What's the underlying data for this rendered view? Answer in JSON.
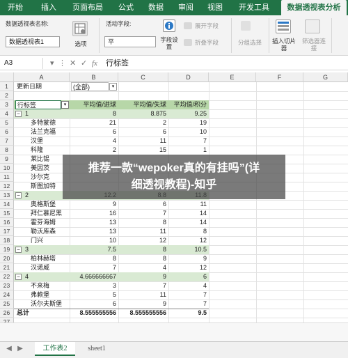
{
  "ribbon_tabs": [
    "开始",
    "插入",
    "页面布局",
    "公式",
    "数据",
    "审阅",
    "视图",
    "开发工具",
    "数据透视表分析"
  ],
  "ribbon": {
    "pt_name_label": "数据透视表名称:",
    "pt_name_value": "数据透视表1",
    "options_label": "选项",
    "active_field_label": "活动字段:",
    "active_field_value": "平",
    "field_settings_label": "字段设置",
    "expand_field_label": "展开字段",
    "collapse_field_label": "折叠字段",
    "group_select_label": "分组选择",
    "insert_slicer_label": "插入切片器",
    "filter_conn_label": "筛选器连接"
  },
  "formula_bar": {
    "cell_ref": "A3",
    "fx": "fx",
    "content": "行标签"
  },
  "columns": [
    "A",
    "B",
    "C",
    "D",
    "E",
    "F",
    "G"
  ],
  "row_numbers": [
    "1",
    "2",
    "3",
    "4",
    "5",
    "6",
    "7",
    "8",
    "9",
    "10",
    "11",
    "12",
    "13",
    "14",
    "15",
    "16",
    "17",
    "18",
    "19",
    "20",
    "21",
    "22",
    "23",
    "24",
    "25",
    "26",
    "27"
  ],
  "filter": {
    "label": "更新日期",
    "value": "(全部)"
  },
  "pivot_header": {
    "row_label": "行标签",
    "col_b": "平均值/进球",
    "col_c": "平均值/失球",
    "col_d": "平均值/积分"
  },
  "rows": [
    {
      "type": "group",
      "a": "1",
      "b": "8",
      "c": "8.875",
      "d": "9.25"
    },
    {
      "type": "item",
      "a": "多特蒙德",
      "b": "21",
      "c": "2",
      "d": "19"
    },
    {
      "type": "item",
      "a": "法兰克福",
      "b": "6",
      "c": "6",
      "d": "10"
    },
    {
      "type": "item",
      "a": "汉堡",
      "b": "4",
      "c": "11",
      "d": "7"
    },
    {
      "type": "item",
      "a": "科隆",
      "b": "2",
      "c": "15",
      "d": "1"
    },
    {
      "type": "item",
      "a": "莱比锡",
      "b": "",
      "c": "",
      "d": ""
    },
    {
      "type": "item",
      "a": "美因茨",
      "b": "",
      "c": "",
      "d": ""
    },
    {
      "type": "item",
      "a": "沙尔克",
      "b": "",
      "c": "",
      "d": ""
    },
    {
      "type": "item",
      "a": "斯图加特",
      "b": "",
      "c": "",
      "d": ""
    },
    {
      "type": "group",
      "a": "2",
      "b": "12.2",
      "c": "8.8",
      "d": "11.8"
    },
    {
      "type": "item",
      "a": "奥格斯堡",
      "b": "9",
      "c": "6",
      "d": "11"
    },
    {
      "type": "item",
      "a": "拜仁慕尼黑",
      "b": "16",
      "c": "7",
      "d": "14"
    },
    {
      "type": "item",
      "a": "霍芬海姆",
      "b": "13",
      "c": "8",
      "d": "14"
    },
    {
      "type": "item",
      "a": "勒沃库森",
      "b": "13",
      "c": "11",
      "d": "8"
    },
    {
      "type": "item",
      "a": "门兴",
      "b": "10",
      "c": "12",
      "d": "12"
    },
    {
      "type": "group",
      "a": "3",
      "b": "7.5",
      "c": "8",
      "d": "10.5"
    },
    {
      "type": "item",
      "a": "柏林赫塔",
      "b": "8",
      "c": "8",
      "d": "9"
    },
    {
      "type": "item",
      "a": "汉诺威",
      "b": "7",
      "c": "4",
      "d": "12"
    },
    {
      "type": "group",
      "a": "4",
      "b": "4.666666667",
      "c": "9",
      "d": "6"
    },
    {
      "type": "item",
      "a": "不来梅",
      "b": "3",
      "c": "7",
      "d": "4"
    },
    {
      "type": "item",
      "a": "弗赖堡",
      "b": "5",
      "c": "11",
      "d": "7"
    },
    {
      "type": "item",
      "a": "沃尔夫斯堡",
      "b": "6",
      "c": "9",
      "d": "7"
    },
    {
      "type": "total",
      "a": "总计",
      "b": "8.555555556",
      "c": "8.555555556",
      "d": "9.5"
    }
  ],
  "sheet_tabs": [
    "工作表2",
    "sheet1"
  ],
  "overlay": {
    "line1": "推荐一款“wepoker真的有挂吗”(详",
    "line2": "细透视教程)-知乎"
  },
  "colors": {
    "excel_green": "#217346",
    "pivot_band": "#d9ead3",
    "pivot_header": "#b7d7a8"
  }
}
